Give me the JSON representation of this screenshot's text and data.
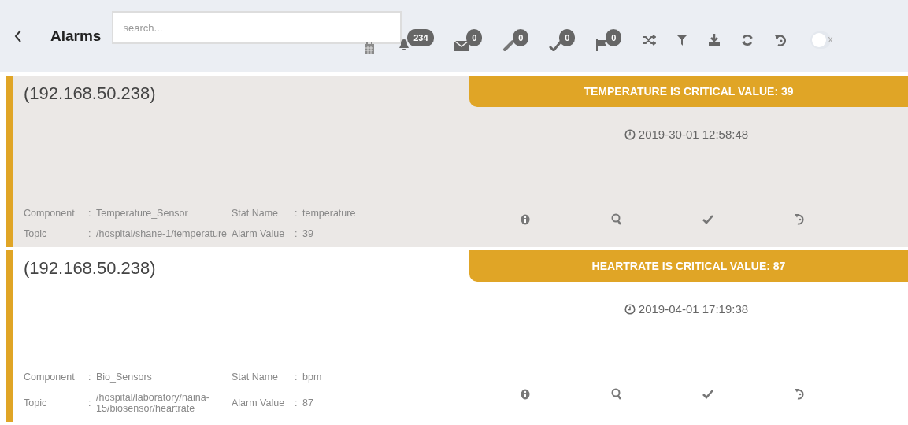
{
  "header": {
    "title": "Alarms",
    "search": {
      "placeholder": "search..."
    },
    "counters": [
      {
        "kind": "bell",
        "count": "234"
      },
      {
        "kind": "mail",
        "count": "0"
      },
      {
        "kind": "pin",
        "count": "0"
      },
      {
        "kind": "check",
        "count": "0"
      },
      {
        "kind": "flag",
        "count": "0"
      }
    ],
    "toggle": {
      "on": false,
      "label": "x"
    }
  },
  "alarms": [
    {
      "selected": true,
      "host": "(192.168.50.238)",
      "message": "TEMPERATURE IS CRITICAL VALUE: 39",
      "time": "2019-30-01 12:58:48",
      "fields": [
        {
          "label": "Component",
          "separator": ":",
          "value": "Temperature_Sensor"
        },
        {
          "label": "Stat Name",
          "separator": ":",
          "value": "temperature"
        },
        {
          "label": "Topic",
          "separator": ":",
          "value": "/hospital/shane-1/temperature"
        },
        {
          "label": "Alarm Value",
          "separator": ":",
          "value": "39"
        }
      ]
    },
    {
      "selected": false,
      "host": "(192.168.50.238)",
      "message": "HEARTRATE IS CRITICAL VALUE: 87",
      "time": "2019-04-01 17:19:38",
      "fields": [
        {
          "label": "Component",
          "separator": ":",
          "value": "Bio_Sensors"
        },
        {
          "label": "Stat Name",
          "separator": ":",
          "value": "bpm"
        },
        {
          "label": "Topic",
          "separator": ":",
          "value": "/hospital/laboratory/naina-15/biosensor/heartrate"
        },
        {
          "label": "Alarm Value",
          "separator": ":",
          "value": "87"
        }
      ]
    }
  ]
}
